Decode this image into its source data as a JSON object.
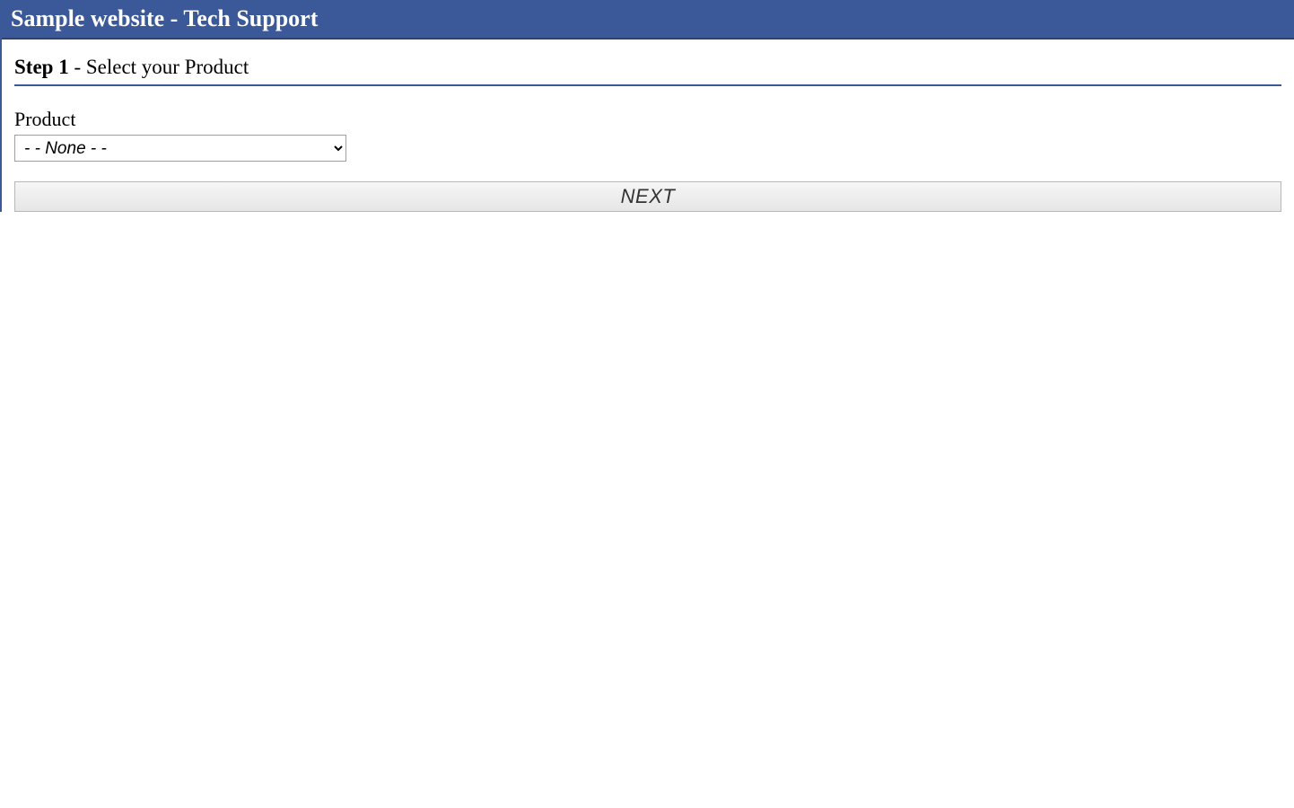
{
  "header": {
    "title": "Sample website - Tech Support"
  },
  "step": {
    "strong": "Step 1",
    "rest": " - Select your Product"
  },
  "product": {
    "label": "Product",
    "selected": "- - None - -"
  },
  "buttons": {
    "next": "NEXT"
  }
}
